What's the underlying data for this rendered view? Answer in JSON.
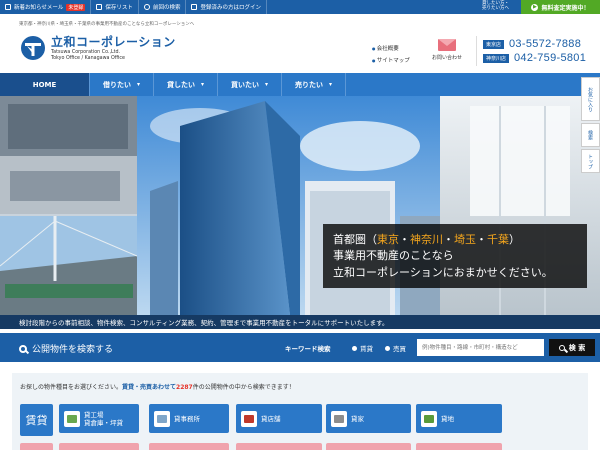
{
  "topbar": {
    "items": [
      {
        "icon": "mail-icon",
        "label": "新着お知らせメール",
        "badge": "未登録"
      },
      {
        "icon": "download-icon",
        "label": "保存リスト"
      },
      {
        "icon": "search-icon",
        "label": "前回の検索"
      },
      {
        "icon": "person-icon",
        "label": "登録済みの方はログイン"
      }
    ],
    "right_text_1": "貸したい方・",
    "right_text_2": "売りたい方へ",
    "cta_label": "無料査定実施中！"
  },
  "header": {
    "tagline": "東京都・神奈川県・埼玉県・千葉県の事業用不動産のことなら立和コーポレーションへ",
    "logo_name": "立和コーポレーション",
    "logo_sub_1": "Tatsuwa Corporation Co.,Ltd.",
    "logo_sub_2": "Tokyo Office / Kanagawa Office",
    "links": [
      "会社概要",
      "サイトマップ"
    ],
    "contact_label": "お問い合わせ",
    "phones": [
      {
        "label": "東京店",
        "number": "03-5572-7888"
      },
      {
        "label": "神奈川店",
        "number": "042-759-5801"
      }
    ]
  },
  "nav": {
    "items": [
      "HOME",
      "借りたい",
      "貸したい",
      "買いたい",
      "売りたい"
    ]
  },
  "side_buttons": [
    "お気に入り",
    "検索",
    "トップ"
  ],
  "hero": {
    "line1_prefix": "首都圏（",
    "areas": [
      "東京",
      "神奈川",
      "埼玉",
      "千葉"
    ],
    "separator": "・",
    "line1_suffix": "）",
    "line2": "事業用不動産のことなら",
    "line3": "立和コーポレーションにおまかせください。",
    "strip_text": "検討段階からの事前相談、物件検索、コンサルティング業務、契約、管理まで事業用不動産をトータルにサポートいたします。"
  },
  "search": {
    "title": "公開物件を検索する",
    "keyword_label": "キーワード検索",
    "radio_rent": "賃貸",
    "radio_sale": "売買",
    "placeholder": "例)物件種目・路線・市町村・構造など",
    "button_label": "検 索"
  },
  "panel": {
    "note_prefix": "お探しの物件種目をお選びください。",
    "note_blue": "賃貸・売買あわせて",
    "note_count": "2287",
    "note_suffix": "件の公開物件の中から検索できます！",
    "rent_label": "賃貸",
    "categories": [
      {
        "label1": "貸工場",
        "label2": "貸倉庫・坪貸",
        "color": "#6aa84f"
      },
      {
        "label1": "貸事務所",
        "label2": "",
        "color": "#7fa6c9"
      },
      {
        "label1": "貸店舗",
        "label2": "",
        "color": "#c0392b"
      },
      {
        "label1": "貸家",
        "label2": "",
        "color": "#8d8d8d"
      },
      {
        "label1": "貸地",
        "label2": "",
        "color": "#5a9b3b"
      }
    ]
  }
}
